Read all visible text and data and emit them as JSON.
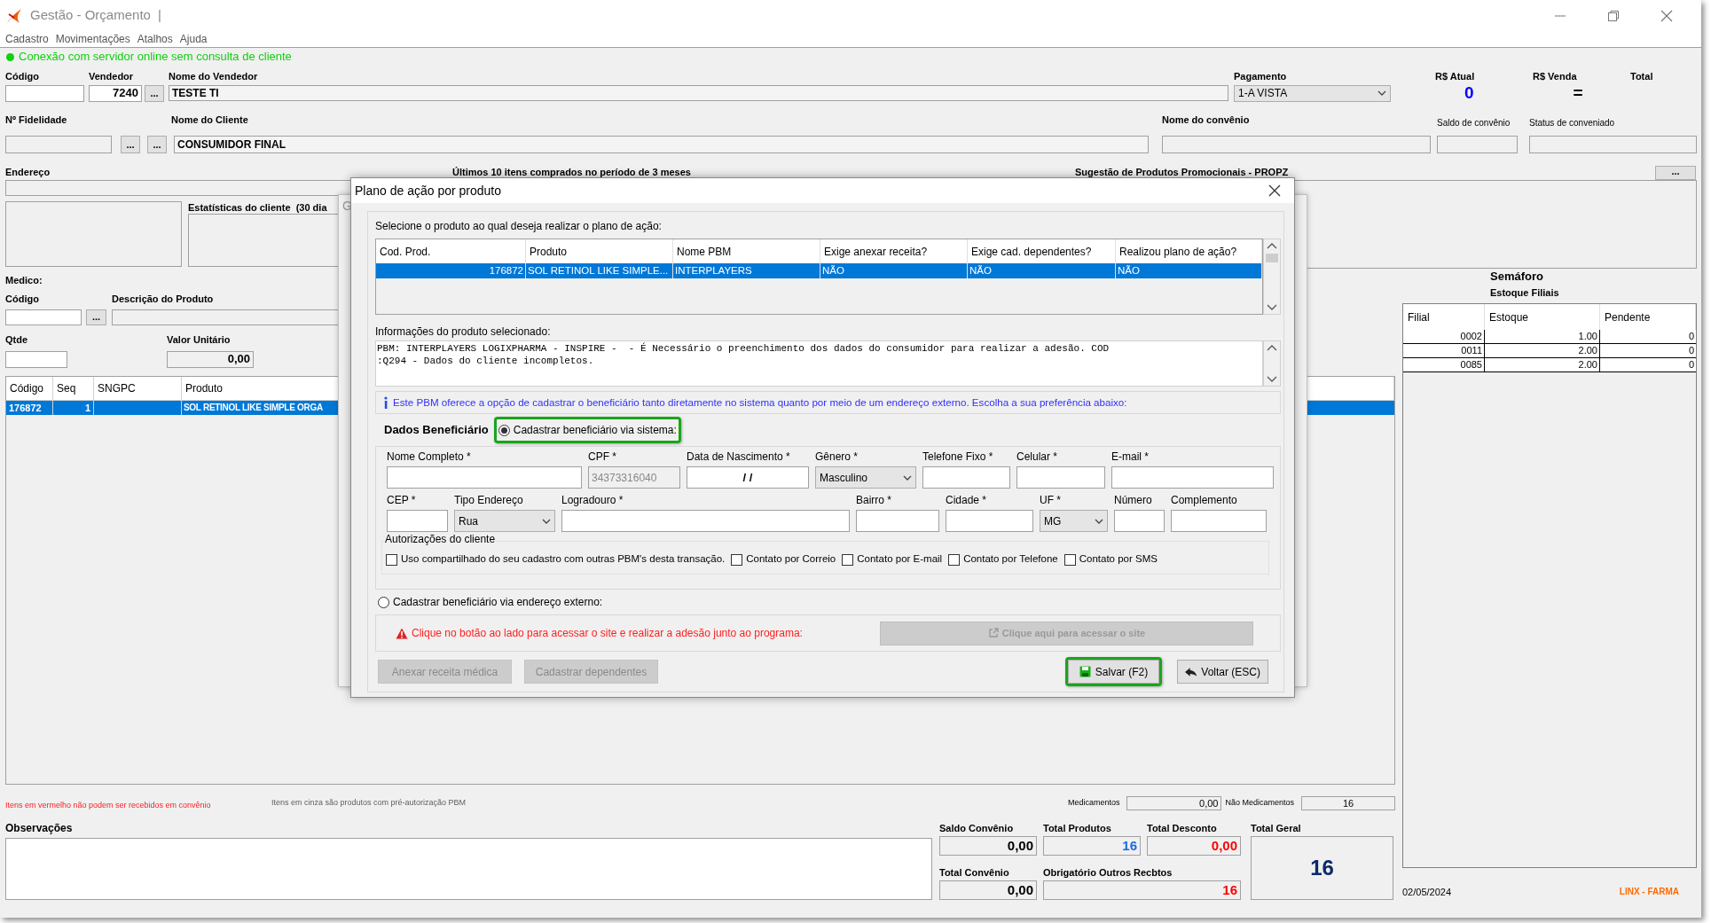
{
  "window": {
    "title": "Gestão - Orçamento",
    "title_suffix": "|"
  },
  "menu": [
    "Cadastro",
    "Movimentações",
    "Atalhos",
    "Ajuda"
  ],
  "connection_status": "Conexão com servidor online sem consulta de cliente",
  "sale": {
    "codigo_label": "Código",
    "vendedor_label": "Vendedor",
    "vendedor": "7240",
    "lookup_button": "...",
    "nome_vendedor_label": "Nome do Vendedor",
    "nome_vendedor": "TESTE TI",
    "pagamento_label": "Pagamento",
    "pagamento": "1-A VISTA",
    "rs_atual_label": "R$ Atual",
    "rs_atual": "0",
    "rs_venda_label": "R$ Venda",
    "rs_venda": "=",
    "total_label": "Total"
  },
  "client": {
    "fidelidade_label": "Nº Fidelidade",
    "buttons": [
      "...",
      "..."
    ],
    "nome_cliente_label": "Nome do Cliente",
    "nome_cliente": "CONSUMIDOR FINAL",
    "convenio_label": "Nome do convênio",
    "saldo_label": "Saldo de convênio",
    "status_label": "Status de conveniado"
  },
  "panels": {
    "endereco_label": "Endereço",
    "ultimos_label": "Últimos 10 itens comprados no período de 3 meses",
    "sugestao_label": "Sugestão de Produtos Promocionais - PROPZ",
    "sugestao_button": "...",
    "estatisticas_label": "Estatísticas do cliente  (30 dia"
  },
  "product_entry": {
    "medico_label": "Medico:",
    "codigo_label": "Código",
    "lookup_button": "...",
    "descricao_label": "Descrição do Produto",
    "qtde_label": "Qtde",
    "valor_label": "Valor Unitário",
    "valor": "0,00"
  },
  "items_table": {
    "columns": [
      "Código",
      "Seq",
      "SNGPC",
      "Produto"
    ],
    "rows": [
      {
        "codigo": "176872",
        "seq": "1",
        "produto": "SOL RETINOL LIKE SIMPLE ORGA",
        "selected": true
      }
    ]
  },
  "notes": [
    {
      "text": "Itens em vermelho não podem ser recebidos em convênio",
      "kind": "restriction"
    },
    {
      "text": "Itens em cinza são produtos com pré-autorização PBM",
      "kind": "hint"
    }
  ],
  "totals": {
    "medicamentos_label": "Medicamentos",
    "medicamentos": "0,00",
    "nao_medicamentos_label": "Não Medicamentos",
    "nao_medicamentos": "16",
    "observacoes_label": "Observações",
    "saldo_convenio_label": "Saldo Convênio",
    "saldo_convenio": "0,00",
    "total_produtos_label": "Total Produtos",
    "total_produtos": "16",
    "total_desconto_label": "Total Desconto",
    "total_desconto": "0,00",
    "total_geral_label": "Total Geral",
    "total_geral": "16",
    "total_convenio_label": "Total Convênio",
    "total_convenio": "0,00",
    "obrigatorio_label": "Obrigatório Outros Recbtos",
    "obrigatorio": "16"
  },
  "stock": {
    "title": "Semáforo",
    "subtitle": "Estoque Filiais",
    "columns": [
      "Filial",
      "Estoque",
      "Pendente"
    ],
    "rows": [
      [
        "0002",
        "1.00",
        "0"
      ],
      [
        "0011",
        "2.00",
        "0"
      ],
      [
        "0085",
        "2.00",
        "0"
      ]
    ]
  },
  "footer": {
    "date": "02/05/2024",
    "brand": "LINX - FARMA"
  },
  "back_window": {
    "title": "G"
  },
  "dialog": {
    "title": "Plano de ação por produto",
    "prompt": "Selecione o produto ao qual deseja realizar o plano de ação:",
    "columns": [
      "Cod. Prod.",
      "Produto",
      "Nome PBM",
      "Exige anexar receita?",
      "Exige cad. dependentes?",
      "Realizou plano de ação?"
    ],
    "rows": [
      {
        "cells": [
          "176872",
          "SOL RETINOL LIKE SIMPLE...",
          "INTERPLAYERS",
          "NÃO",
          "NÃO",
          "NÃO"
        ],
        "selected": true
      }
    ],
    "info_label": "Informações do produto selecionado:",
    "info_lines": [
      "PBM: INTERPLAYERS LOGIXPHARMA - INSPIRE -  - É Necessário o preenchimento dos dados do consumidor para realizar a adesão. COD",
      ":Q294 - Dados do cliente incompletos."
    ],
    "notice": "Este PBM oferece a opção de cadastrar o beneficiário tanto diretamente no sistema quanto por meio de um endereço externo. Escolha a sua preferência abaixo:",
    "section_label": "Dados Beneficiário",
    "options": [
      {
        "label": "Cadastrar beneficiário via sistema:",
        "selected": true,
        "highlighted": true
      },
      {
        "label": "Cadastrar beneficiário via endereço externo:",
        "selected": false,
        "highlighted": false
      }
    ],
    "field_rows": [
      [
        {
          "label": "Nome Completo *",
          "kind": "text",
          "disabled": false
        },
        {
          "label": "CPF *",
          "kind": "text",
          "value": "34373316040",
          "disabled": true
        },
        {
          "label": "Data de Nascimento *",
          "kind": "date",
          "value": "/ /",
          "disabled": false
        },
        {
          "label": "Gênero *",
          "kind": "select",
          "value": "Masculino",
          "disabled": false
        },
        {
          "label": "Telefone Fixo *",
          "kind": "text",
          "disabled": false
        },
        {
          "label": "Celular *",
          "kind": "text",
          "disabled": false
        },
        {
          "label": "E-mail *",
          "kind": "text",
          "disabled": false
        }
      ],
      [
        {
          "label": "CEP *",
          "kind": "text",
          "disabled": false
        },
        {
          "label": "Tipo Endereço",
          "kind": "select",
          "value": "Rua",
          "disabled": false
        },
        {
          "label": "Logradouro *",
          "kind": "text",
          "disabled": false
        },
        {
          "label": "Bairro *",
          "kind": "text",
          "disabled": false
        },
        {
          "label": "Cidade *",
          "kind": "text",
          "disabled": false
        },
        {
          "label": "UF *",
          "kind": "select",
          "value": "MG",
          "disabled": false
        },
        {
          "label": "Número",
          "kind": "text",
          "disabled": false
        },
        {
          "label": "Complemento",
          "kind": "text",
          "disabled": false
        }
      ]
    ],
    "authorizations": {
      "title": "Autorizações do cliente",
      "items": [
        {
          "label": "Uso compartilhado do seu cadastro com outras PBM's desta transação.",
          "checked": false
        },
        {
          "label": "Contato por Correio",
          "checked": false
        },
        {
          "label": "Contato por E-mail",
          "checked": false
        },
        {
          "label": "Contato por Telefone",
          "checked": false
        },
        {
          "label": "Contato por SMS",
          "checked": false
        }
      ]
    },
    "external": {
      "warning": "Clique no botão ao lado para acessar o site e realizar a adesão junto ao programa:",
      "button": {
        "label": "Clique aqui para acessar o site",
        "disabled": true
      }
    },
    "buttons": [
      {
        "label": "Anexar receita médica",
        "kind": "plain",
        "disabled": true,
        "highlighted": false
      },
      {
        "label": "Cadastrar dependentes",
        "kind": "plain",
        "disabled": true,
        "highlighted": false
      },
      {
        "label": "Salvar (F2)",
        "kind": "save",
        "disabled": false,
        "highlighted": true
      },
      {
        "label": "Voltar (ESC)",
        "kind": "back",
        "disabled": false,
        "highlighted": false
      }
    ]
  }
}
